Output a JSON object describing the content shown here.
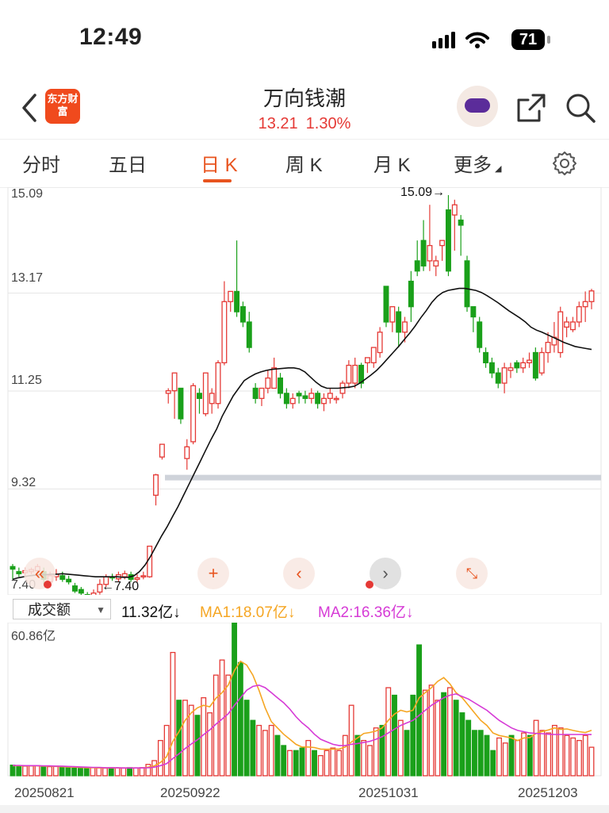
{
  "status_bar": {
    "time": "12:49",
    "battery": "71"
  },
  "header": {
    "logo_text": "东方财富",
    "stock_name": "万向钱潮",
    "price": "13.21",
    "change_pct": "1.30%"
  },
  "tabs": [
    {
      "label": "分时",
      "active": false
    },
    {
      "label": "五日",
      "active": false
    },
    {
      "label": "日 K",
      "active": true
    },
    {
      "label": "周 K",
      "active": false
    },
    {
      "label": "月 K",
      "active": false
    },
    {
      "label": "更多",
      "active": false
    }
  ],
  "price_chart": {
    "y_labels": [
      "15.09",
      "13.17",
      "11.25",
      "9.32",
      "7.40"
    ],
    "max_annotation": "15.09→",
    "min_annotation": "←7.40"
  },
  "volume_panel": {
    "indicator_select": "成交额",
    "value": "11.32亿",
    "ma1": "MA1:18.07亿",
    "ma2": "MA2:16.36亿",
    "max_label": "60.86亿"
  },
  "dates": [
    "20250821",
    "20250922",
    "20251031",
    "20251203"
  ],
  "colors": {
    "up": "#e53935",
    "down": "#1aa01a",
    "ma_price": "#111111",
    "ma1": "#f5a623",
    "ma2": "#d63ad6",
    "accent": "#e8541f"
  },
  "chart_data": [
    {
      "type": "candlestick",
      "ylim": [
        7.4,
        15.09
      ],
      "ohlc": [
        [
          7.8,
          7.75,
          7.55,
          7.85
        ],
        [
          7.7,
          7.66,
          7.6,
          7.78
        ],
        [
          7.68,
          7.72,
          7.6,
          7.78
        ],
        [
          7.7,
          7.74,
          7.65,
          7.78
        ],
        [
          7.72,
          7.8,
          7.68,
          7.85
        ],
        [
          7.7,
          7.55,
          7.45,
          7.78
        ],
        [
          7.5,
          7.62,
          7.4,
          7.7
        ],
        [
          7.6,
          7.65,
          7.52,
          7.75
        ],
        [
          7.62,
          7.55,
          7.5,
          7.7
        ],
        [
          7.55,
          7.5,
          7.45,
          7.62
        ],
        [
          7.42,
          7.32,
          7.28,
          7.48
        ],
        [
          7.35,
          7.28,
          7.22,
          7.4
        ],
        [
          7.25,
          7.15,
          7.1,
          7.3
        ],
        [
          7.2,
          7.28,
          7.1,
          7.35
        ],
        [
          7.3,
          7.45,
          7.25,
          7.55
        ],
        [
          7.45,
          7.6,
          7.4,
          7.65
        ],
        [
          7.6,
          7.58,
          7.52,
          7.66
        ],
        [
          7.56,
          7.64,
          7.5,
          7.7
        ],
        [
          7.6,
          7.66,
          7.55,
          7.72
        ],
        [
          7.64,
          7.55,
          7.5,
          7.7
        ],
        [
          7.55,
          7.58,
          7.5,
          7.65
        ],
        [
          7.6,
          7.62,
          7.55,
          7.7
        ],
        [
          7.6,
          8.2,
          7.58,
          8.2
        ],
        [
          9.2,
          9.6,
          9.0,
          9.62
        ],
        [
          9.95,
          10.2,
          9.9,
          10.2
        ],
        [
          11.2,
          11.25,
          11.0,
          11.3
        ],
        [
          11.25,
          11.6,
          10.7,
          11.6
        ],
        [
          11.3,
          10.7,
          10.6,
          11.3
        ],
        [
          9.92,
          10.15,
          9.7,
          10.3
        ],
        [
          10.25,
          11.35,
          10.2,
          11.4
        ],
        [
          11.2,
          11.1,
          10.8,
          11.3
        ],
        [
          10.8,
          11.6,
          10.75,
          11.6
        ],
        [
          11.0,
          11.2,
          10.8,
          11.3
        ],
        [
          11.0,
          11.8,
          10.9,
          11.85
        ],
        [
          11.8,
          13.0,
          11.75,
          13.4
        ],
        [
          13.0,
          13.2,
          12.8,
          13.2
        ],
        [
          13.2,
          12.8,
          12.7,
          14.2
        ],
        [
          12.9,
          12.6,
          12.5,
          13.0
        ],
        [
          12.6,
          12.1,
          12.0,
          12.8
        ],
        [
          11.3,
          11.1,
          11.0,
          11.4
        ],
        [
          11.1,
          11.3,
          10.95,
          11.3
        ],
        [
          11.3,
          11.5,
          11.2,
          11.65
        ],
        [
          11.3,
          11.7,
          11.3,
          11.9
        ],
        [
          11.5,
          11.2,
          11.1,
          11.6
        ],
        [
          11.2,
          11.0,
          10.9,
          11.3
        ],
        [
          11.0,
          11.1,
          10.9,
          11.2
        ],
        [
          11.2,
          11.15,
          11.0,
          11.25
        ],
        [
          11.15,
          11.1,
          11.0,
          11.25
        ],
        [
          11.1,
          11.2,
          11.0,
          11.3
        ],
        [
          11.2,
          11.0,
          10.9,
          11.25
        ],
        [
          11.0,
          11.1,
          10.85,
          11.2
        ],
        [
          11.1,
          11.2,
          11.0,
          11.3
        ],
        [
          11.1,
          11.1,
          11.0,
          11.15
        ],
        [
          11.2,
          11.4,
          11.1,
          11.45
        ],
        [
          11.4,
          11.75,
          11.3,
          11.85
        ],
        [
          11.4,
          11.75,
          11.3,
          11.9
        ],
        [
          11.75,
          11.4,
          11.3,
          11.8
        ],
        [
          11.8,
          11.9,
          11.6,
          11.9
        ],
        [
          11.8,
          12.1,
          11.7,
          12.1
        ],
        [
          12.0,
          12.4,
          11.9,
          12.5
        ],
        [
          13.3,
          12.6,
          12.5,
          13.3
        ],
        [
          12.6,
          12.9,
          12.4,
          12.9
        ],
        [
          12.8,
          12.4,
          12.1,
          12.9
        ],
        [
          12.4,
          12.6,
          12.2,
          12.7
        ],
        [
          13.4,
          12.9,
          12.6,
          13.6
        ],
        [
          13.8,
          13.6,
          13.5,
          14.2
        ],
        [
          14.2,
          13.7,
          13.6,
          14.6
        ],
        [
          13.8,
          14.1,
          13.6,
          14.9
        ],
        [
          13.7,
          13.8,
          13.5,
          13.9
        ],
        [
          14.1,
          14.2,
          13.8,
          14.2
        ],
        [
          14.8,
          13.6,
          13.5,
          15.09
        ],
        [
          14.7,
          14.9,
          14.0,
          15.0
        ],
        [
          14.6,
          14.5,
          13.9,
          14.7
        ],
        [
          13.8,
          12.9,
          12.8,
          13.9
        ],
        [
          12.9,
          12.7,
          12.4,
          12.9
        ],
        [
          12.6,
          12.1,
          12.0,
          12.7
        ],
        [
          12.0,
          11.8,
          11.7,
          12.1
        ],
        [
          11.8,
          11.6,
          11.5,
          11.9
        ],
        [
          11.6,
          11.4,
          11.3,
          11.7
        ],
        [
          11.4,
          11.7,
          11.2,
          11.8
        ],
        [
          11.65,
          11.7,
          11.5,
          11.8
        ],
        [
          11.8,
          11.7,
          11.6,
          11.85
        ],
        [
          11.7,
          11.8,
          11.6,
          11.9
        ],
        [
          11.8,
          11.85,
          11.7,
          12.0
        ],
        [
          12.0,
          11.5,
          11.45,
          12.1
        ],
        [
          11.6,
          12.0,
          11.55,
          12.1
        ],
        [
          12.0,
          12.2,
          11.8,
          12.4
        ],
        [
          12.15,
          12.3,
          12.0,
          12.6
        ],
        [
          12.0,
          12.8,
          11.9,
          12.9
        ],
        [
          12.5,
          12.6,
          12.3,
          12.7
        ],
        [
          12.45,
          12.6,
          12.4,
          12.7
        ],
        [
          12.6,
          12.9,
          12.5,
          13.0
        ],
        [
          12.9,
          13.0,
          12.6,
          13.2
        ],
        [
          13.0,
          13.21,
          12.85,
          13.25
        ]
      ],
      "ma": [
        7.55,
        7.58,
        7.6,
        7.62,
        7.63,
        7.64,
        7.64,
        7.65,
        7.65,
        7.66,
        7.65,
        7.64,
        7.63,
        7.62,
        7.61,
        7.6,
        7.6,
        7.6,
        7.6,
        7.6,
        7.59,
        7.59,
        7.62,
        7.7,
        7.83,
        8.0,
        8.2,
        8.4,
        8.58,
        8.78,
        8.98,
        9.2,
        9.42,
        9.64,
        9.86,
        10.08,
        10.3,
        10.5,
        10.75,
        10.95,
        11.15,
        11.3,
        11.45,
        11.52,
        11.58,
        11.62,
        11.65,
        11.67,
        11.68,
        11.69,
        11.7,
        11.7,
        11.68,
        11.62,
        11.52,
        11.42,
        11.34,
        11.3,
        11.3,
        11.3,
        11.31,
        11.32,
        11.34,
        11.4,
        11.48,
        11.56,
        11.65,
        11.76,
        11.88,
        12.0,
        12.12,
        12.25,
        12.38,
        12.52,
        12.68,
        12.82,
        12.98,
        13.1,
        13.18,
        13.22,
        13.24,
        13.26,
        13.26,
        13.24,
        13.22,
        13.18,
        13.12,
        13.05,
        12.98,
        12.9,
        12.82,
        12.75,
        12.68,
        12.6,
        12.5,
        12.44,
        12.4,
        12.35,
        12.3,
        12.25,
        12.2,
        12.16,
        12.12,
        12.1,
        12.08,
        12.06
      ]
    },
    {
      "type": "bar",
      "ylim": [
        0,
        60.86
      ],
      "unit": "亿",
      "values": [
        4.2,
        4.0,
        3.8,
        3.9,
        4.0,
        3.7,
        3.6,
        3.8,
        3.5,
        3.3,
        3.0,
        2.9,
        3.1,
        3.2,
        3.1,
        3.0,
        3.2,
        3.1,
        3.0,
        3.2,
        3.1,
        3.2,
        4.5,
        6.0,
        14.0,
        20.0,
        49.0,
        30.0,
        30.0,
        28.0,
        24.0,
        31.0,
        25.0,
        40.0,
        46.0,
        40.0,
        60.86,
        45.0,
        30.0,
        22.0,
        20.0,
        18.0,
        20.0,
        16.0,
        12.0,
        10.0,
        10.0,
        11.0,
        14.0,
        10.0,
        8.0,
        10.0,
        11.0,
        10.0,
        16.0,
        28.0,
        16.0,
        14.0,
        12.0,
        19.0,
        20.0,
        35.0,
        32.0,
        22.0,
        18.0,
        32.0,
        52.0,
        34.0,
        36.0,
        30.0,
        33.0,
        35.0,
        30.0,
        25.0,
        22.0,
        18.0,
        18.0,
        16.0,
        10.0,
        15.0,
        13.0,
        16.0,
        14.0,
        17.0,
        16.0,
        22.0,
        18.0,
        17.0,
        20.0,
        19.0,
        16.0,
        15.0,
        14.0,
        16.0,
        11.32
      ],
      "ma1": [
        4.0,
        4.0,
        3.9,
        3.9,
        3.9,
        3.8,
        3.8,
        3.7,
        3.6,
        3.5,
        3.4,
        3.3,
        3.2,
        3.2,
        3.1,
        3.1,
        3.1,
        3.1,
        3.1,
        3.1,
        3.1,
        3.1,
        3.4,
        3.9,
        5.3,
        7.6,
        13.6,
        17.5,
        22.0,
        25.0,
        27.0,
        28.0,
        27.4,
        30.8,
        33.0,
        36.0,
        41.8,
        45.5,
        44.0,
        40.0,
        34.0,
        27.0,
        21.5,
        19.0,
        16.5,
        14.5,
        12.5,
        11.4,
        11.4,
        11.2,
        10.6,
        10.5,
        10.6,
        10.6,
        11.4,
        13.4,
        15.0,
        16.8,
        17.2,
        17.8,
        19.0,
        22.0,
        24.5,
        26.0,
        25.4,
        26.0,
        31.0,
        33.0,
        35.0,
        37.5,
        39.0,
        36.5,
        33.0,
        31.0,
        28.0,
        25.0,
        22.0,
        20.0,
        17.0,
        16.0,
        15.5,
        15.0,
        14.0,
        15.0,
        15.2,
        16.8,
        17.6,
        18.2,
        19.0,
        18.4,
        18.6,
        18.0,
        17.5,
        17.2,
        18.07
      ],
      "ma2": [
        4.1,
        4.1,
        4.0,
        4.0,
        4.0,
        3.9,
        3.9,
        3.8,
        3.8,
        3.7,
        3.6,
        3.5,
        3.4,
        3.3,
        3.3,
        3.2,
        3.2,
        3.2,
        3.1,
        3.1,
        3.1,
        3.1,
        3.2,
        3.4,
        4.0,
        4.8,
        6.8,
        8.7,
        10.8,
        12.6,
        14.3,
        16.3,
        18.2,
        20.5,
        22.5,
        24.6,
        28.0,
        31.0,
        34.0,
        35.5,
        36.0,
        35.0,
        33.0,
        31.0,
        29.0,
        26.5,
        23.5,
        21.0,
        19.0,
        16.5,
        14.5,
        13.5,
        12.5,
        12.0,
        12.0,
        12.5,
        12.8,
        13.2,
        13.7,
        14.5,
        15.5,
        17.0,
        18.5,
        20.0,
        21.0,
        22.0,
        24.0,
        26.0,
        28.0,
        29.5,
        31.0,
        32.0,
        32.5,
        31.5,
        30.5,
        29.0,
        27.5,
        26.0,
        24.0,
        22.0,
        20.5,
        19.0,
        18.0,
        17.5,
        17.0,
        16.8,
        16.7,
        16.5,
        16.4,
        16.4,
        16.4,
        16.4,
        16.4,
        16.36,
        16.36
      ]
    }
  ]
}
